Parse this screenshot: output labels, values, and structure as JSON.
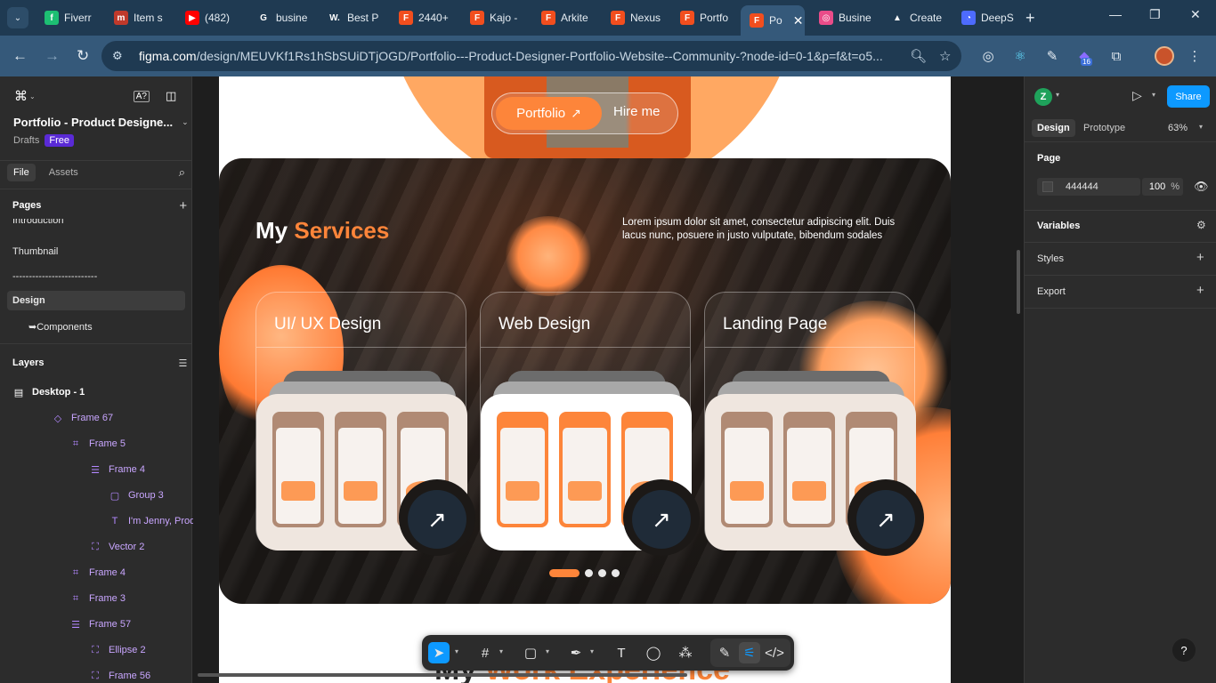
{
  "browser": {
    "tabs": [
      {
        "label": "Fiverr",
        "fav": "f",
        "color": "#1dbf73"
      },
      {
        "label": "Item s",
        "fav": "m",
        "color": "#c0392b"
      },
      {
        "label": "(482)",
        "fav": "▶",
        "color": "#ff0000"
      },
      {
        "label": "busine",
        "fav": "G",
        "color": "#ffffff"
      },
      {
        "label": "Best P",
        "fav": "W.",
        "color": "#ffffff"
      },
      {
        "label": "2440+",
        "fav": "F",
        "color": "#f24e1e"
      },
      {
        "label": "Kajo -",
        "fav": "F",
        "color": "#f24e1e"
      },
      {
        "label": "Arkite",
        "fav": "F",
        "color": "#f24e1e"
      },
      {
        "label": "Nexus",
        "fav": "F",
        "color": "#f24e1e"
      },
      {
        "label": "Portfo",
        "fav": "F",
        "color": "#f24e1e"
      },
      {
        "label": "Po",
        "fav": "F",
        "color": "#f24e1e"
      },
      {
        "label": "Busine",
        "fav": "◎",
        "color": "#ea4c89"
      },
      {
        "label": "Create",
        "fav": "▲",
        "color": "#ffffff"
      },
      {
        "label": "DeepS",
        "fav": "◔",
        "color": "#4d6bfe"
      }
    ],
    "active_tab_index": 10,
    "url_domain": "figma.com",
    "url_path": "/design/MEUVKf1Rs1hSbSUiDTjOGD/Portfolio---Product-Designer-Portfolio-Website--Community-?node-id=0-1&p=f&t=o5...",
    "extension_badge": "16"
  },
  "left_panel": {
    "file_name": "Portfolio - Product Designe...",
    "location": "Drafts",
    "plan_badge": "Free",
    "tab_file": "File",
    "tab_assets": "Assets",
    "pages_heading": "Pages",
    "pages": [
      {
        "label": "Introduction",
        "selected": false
      },
      {
        "label": "Thumbnail",
        "selected": false
      },
      {
        "label": "--------------------------",
        "selected": false
      },
      {
        "label": "Design",
        "selected": true
      },
      {
        "label": "➥Components",
        "selected": false
      }
    ],
    "layers_heading": "Layers",
    "layers": [
      {
        "label": "Desktop - 1",
        "icon": "▤",
        "indent": 0,
        "top": true
      },
      {
        "label": "Frame 67",
        "icon": "◇",
        "indent": 1
      },
      {
        "label": "Frame 5",
        "icon": "⌗",
        "indent": 2
      },
      {
        "label": "Frame 4",
        "icon": "☰",
        "indent": 3
      },
      {
        "label": "Group 3",
        "icon": "▢",
        "indent": 4
      },
      {
        "label": "I'm Jenny, Prod",
        "icon": "T",
        "indent": 4
      },
      {
        "label": "Vector 2",
        "icon": "⛶",
        "indent": 3
      },
      {
        "label": "Frame 4",
        "icon": "⌗",
        "indent": 2
      },
      {
        "label": "Frame 3",
        "icon": "⌗",
        "indent": 2
      },
      {
        "label": "Frame 57",
        "icon": "☰",
        "indent": 2
      },
      {
        "label": "Ellipse 2",
        "icon": "⛶",
        "indent": 3
      },
      {
        "label": "Frame 56",
        "icon": "⛶",
        "indent": 3
      }
    ]
  },
  "canvas": {
    "hero": {
      "portfolio_btn": "Portfolio",
      "hire_btn": "Hire me"
    },
    "services": {
      "title_plain": "My",
      "title_accent": "Services",
      "description": "Lorem ipsum dolor sit amet, consectetur adipiscing elit. Duis lacus nunc, posuere in justo vulputate, bibendum sodales",
      "cards": [
        {
          "title": "UI/ UX Design"
        },
        {
          "title": "Web Design"
        },
        {
          "title": "Landing Page"
        }
      ],
      "carousel_pages": 4,
      "carousel_active": 0
    },
    "next_heading_plain": "My",
    "next_heading_accent": "Work Experience"
  },
  "toolbar": {
    "tools": [
      "move",
      "frame",
      "shape",
      "pen",
      "text",
      "comment",
      "actions"
    ],
    "active_tool": "move",
    "right_tools": [
      "draw",
      "design-mode",
      "dev-mode"
    ]
  },
  "right_panel": {
    "avatar_letter": "Z",
    "share_label": "Share",
    "tab_design": "Design",
    "tab_prototype": "Prototype",
    "zoom": "63%",
    "page_heading": "Page",
    "page_color": "444444",
    "page_opacity": "100",
    "opacity_unit": "%",
    "variables_heading": "Variables",
    "styles_heading": "Styles",
    "export_heading": "Export",
    "help_label": "?"
  },
  "colors": {
    "accent": "#fd853a",
    "figma_blue": "#0d99ff",
    "layer_purple": "#c9a6ff"
  }
}
